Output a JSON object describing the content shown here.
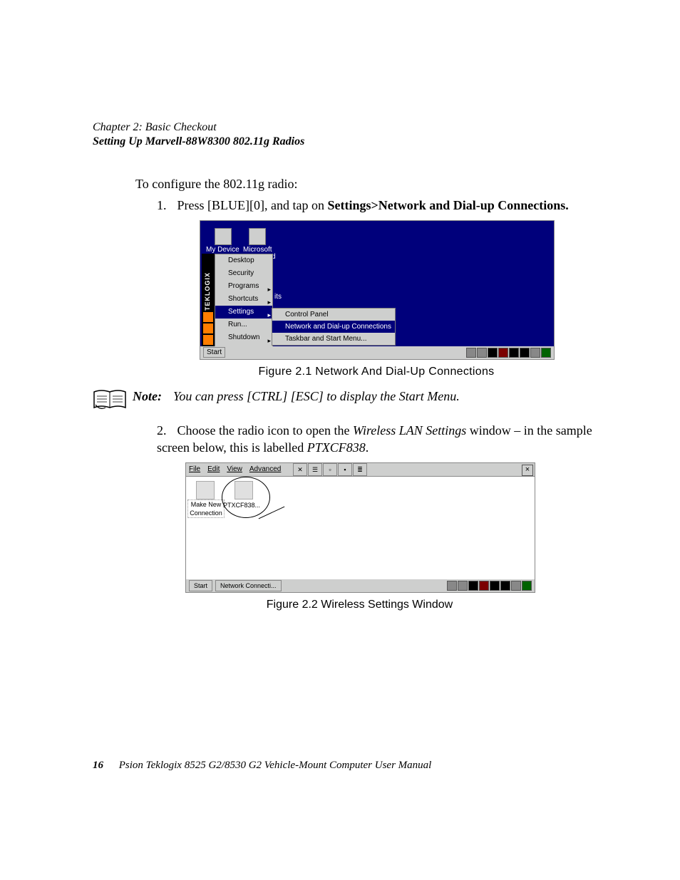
{
  "header": {
    "chapter": "Chapter 2: Basic Checkout",
    "section": "Setting Up Marvell-88W8300 802.11g Radios"
  },
  "intro": "To configure the 802.11g radio:",
  "steps": {
    "s1_num": "1.",
    "s1_a": "Press [BLUE][0], and tap on ",
    "s1_b": "Settings>Network and Dial-up Connections.",
    "s2_num": "2.",
    "s2_a": "Choose the radio icon to open the ",
    "s2_b": "Wireless LAN Settings",
    "s2_c": " window – in the sample screen below, this is labelled ",
    "s2_d": "PTXCF838",
    "s2_e": "."
  },
  "fig1": {
    "desk_label1": "My Device",
    "desk_label2": "Microsoft",
    "sidebar_text": "TEKLOGIX",
    "menu": {
      "desktop": "Desktop",
      "security": "Security",
      "programs": "Programs",
      "shortcuts": "Shortcuts",
      "settings": "Settings",
      "run": "Run...",
      "shutdown": "Shutdown"
    },
    "submenu": {
      "control_panel": "Control Panel",
      "network": "Network and Dial-up Connections",
      "taskbar": "Taskbar and Start Menu..."
    },
    "bg_its": "its",
    "bg_d": "d",
    "start": "Start",
    "caption": "Figure 2.1 Network And Dial-Up Connections"
  },
  "note": {
    "label": "Note:",
    "text": "You can press [CTRL] [ESC] to display the Start Menu."
  },
  "fig2": {
    "menu": {
      "file": "File",
      "edit": "Edit",
      "view": "View",
      "advanced": "Advanced"
    },
    "tool_x": "✕",
    "close": "×",
    "icon1_label": "Make New Connection",
    "icon2_label": "PTXCF838...",
    "start": "Start",
    "task_item": "Network Connecti...",
    "caption": "Figure 2.2 Wireless Settings Window"
  },
  "footer": {
    "page": "16",
    "text": "Psion Teklogix 8525 G2/8530 G2 Vehicle-Mount Computer User Manual"
  }
}
